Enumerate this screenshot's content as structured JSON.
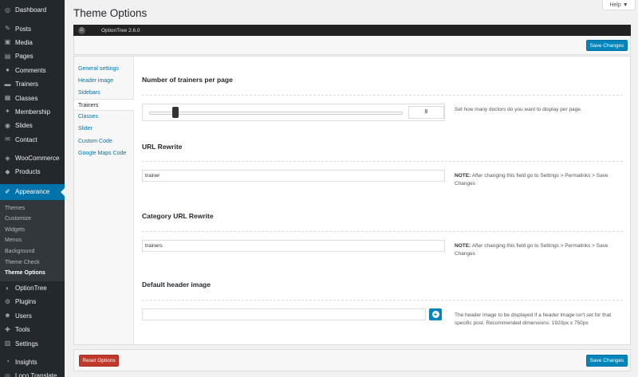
{
  "sidebar": {
    "items": [
      {
        "label": "Dashboard",
        "icon": "dashboard-icon",
        "glyph": "◎"
      },
      {
        "sep": true
      },
      {
        "label": "Posts",
        "icon": "pin-icon",
        "glyph": "✎"
      },
      {
        "label": "Media",
        "icon": "media-icon",
        "glyph": "▣"
      },
      {
        "label": "Pages",
        "icon": "pages-icon",
        "glyph": "▤"
      },
      {
        "label": "Comments",
        "icon": "comments-icon",
        "glyph": "●"
      },
      {
        "label": "Trainers",
        "icon": "trainers-icon",
        "glyph": "▬"
      },
      {
        "label": "Classes",
        "icon": "classes-icon",
        "glyph": "▦"
      },
      {
        "label": "Membership",
        "icon": "membership-icon",
        "glyph": "✦"
      },
      {
        "label": "Slides",
        "icon": "slides-icon",
        "glyph": "◉"
      },
      {
        "label": "Contact",
        "icon": "contact-icon",
        "glyph": "✉"
      },
      {
        "sep": true
      },
      {
        "label": "WooCommerce",
        "icon": "woocommerce-icon",
        "glyph": "◈"
      },
      {
        "label": "Products",
        "icon": "products-icon",
        "glyph": "◆"
      },
      {
        "sep": true
      },
      {
        "label": "Appearance",
        "icon": "appearance-icon",
        "glyph": "✐",
        "active": true
      }
    ],
    "submenu": [
      "Themes",
      "Customize",
      "Widgets",
      "Menus",
      "Background",
      "Theme Check",
      "Theme Options"
    ],
    "submenu_current": 6,
    "items_after": [
      {
        "label": "OptionTree",
        "icon": "optiontree-icon",
        "glyph": "◐"
      },
      {
        "label": "Plugins",
        "icon": "plugins-icon",
        "glyph": "⚙"
      },
      {
        "label": "Users",
        "icon": "users-icon",
        "glyph": "☻"
      },
      {
        "label": "Tools",
        "icon": "tools-icon",
        "glyph": "✚"
      },
      {
        "label": "Settings",
        "icon": "settings-icon",
        "glyph": "▥"
      },
      {
        "sep": true
      },
      {
        "label": "Insights",
        "icon": "insights-icon",
        "glyph": "◔"
      },
      {
        "label": "Loco Translate",
        "icon": "loco-translate-icon",
        "glyph": "◎"
      }
    ]
  },
  "header": {
    "title": "Theme Options",
    "help_label": "Help ▼"
  },
  "optiontree": {
    "version": "OptionTree 2.6.0",
    "logo_glyph": "Ω"
  },
  "actions": {
    "save_label": "Save Changes",
    "reset_label": "Reset Options"
  },
  "tabs": [
    "General settings",
    "Header image",
    "Sidebars",
    "Trainers",
    "Classes",
    "Slider",
    "Custom Code",
    "Google Maps Code"
  ],
  "active_tab": 3,
  "fields": {
    "trainers_per_page": {
      "title": "Number of trainers per page",
      "value": "8",
      "slider_fraction": 0.09,
      "description": "Set how many doctors do you want to display per page."
    },
    "url_rewrite": {
      "title": "URL Rewrite",
      "value": "trainer",
      "note_label": "NOTE:",
      "note_text": "After changing this field go to Settings > Permalinks > Save Changes"
    },
    "category_url_rewrite": {
      "title": "Category URL Rewrite",
      "value": "trainers",
      "note_label": "NOTE:",
      "note_text": "After changing this field go to Settings > Permalinks > Save Changes"
    },
    "default_header_image": {
      "title": "Default header image",
      "value": "",
      "description": "The header image to be displayed if a header image isn't set for that specific post. Recommended dimensions: 1920px x 750px",
      "upload_glyph": "+"
    }
  },
  "colors": {
    "sidebar_bg": "#23282d",
    "accent": "#0073aa",
    "primary_button": "#0085ba",
    "reset_button": "#c0392b"
  }
}
